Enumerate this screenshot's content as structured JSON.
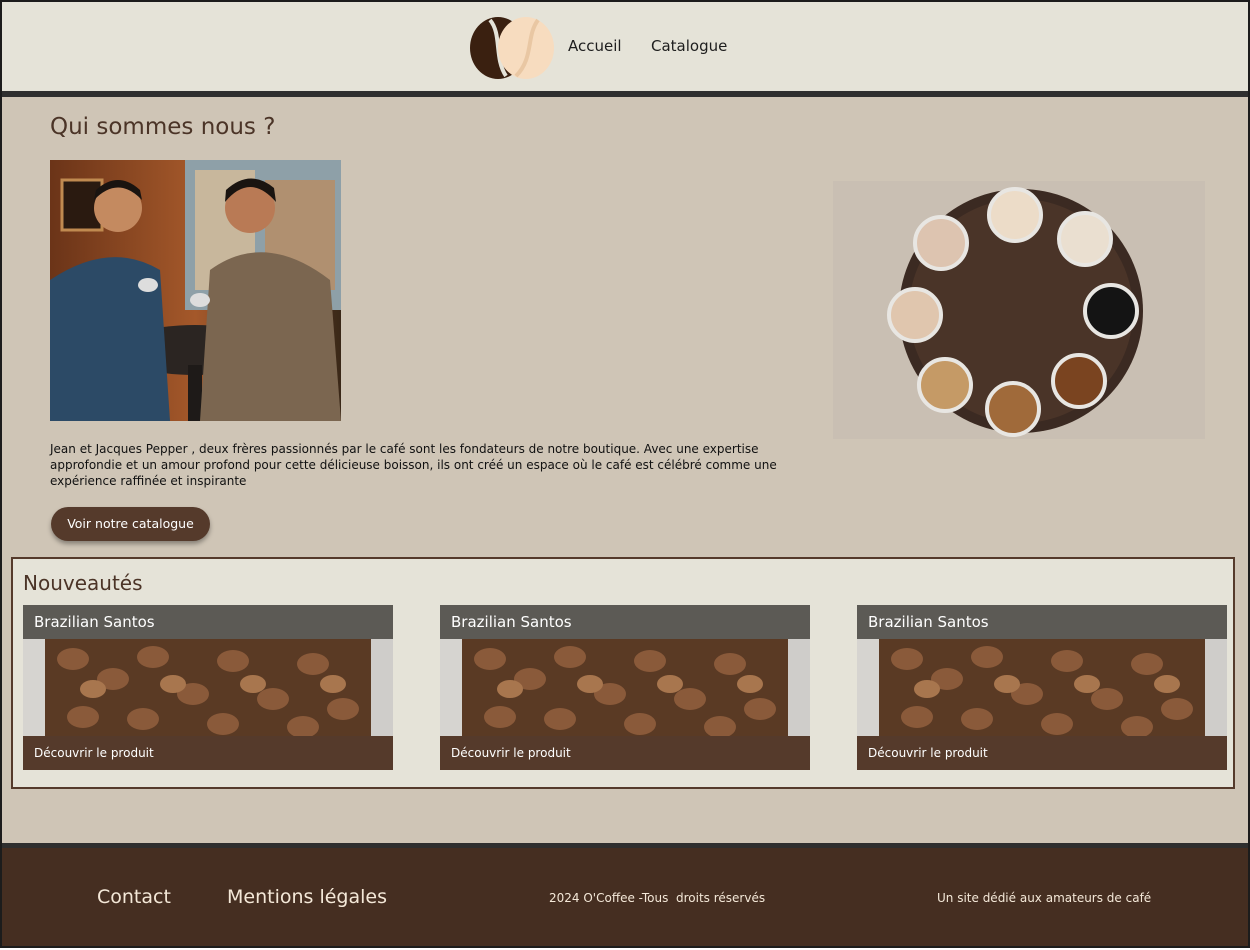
{
  "header": {
    "logo_icon": "coffee-bean-logo-icon",
    "nav": [
      {
        "label": "Accueil"
      },
      {
        "label": "Catalogue"
      }
    ]
  },
  "about": {
    "title": "Qui sommes nous ?",
    "text": "Jean et Jacques Pepper , deux frères passionnés par le café sont les fondateurs de notre boutique. Avec une expertise approfondie et un amour profond pour cette délicieuse boisson, ils ont créé un espace où le café est célébré comme une expérience raffinée et inspirante",
    "cta_label": "Voir notre catalogue"
  },
  "news": {
    "title": "Nouveautés",
    "cards": [
      {
        "name": "Brazilian Santos",
        "link_label": "Découvrir le produit"
      },
      {
        "name": "Brazilian Santos",
        "link_label": "Découvrir le produit"
      },
      {
        "name": "Brazilian Santos",
        "link_label": "Découvrir le produit"
      }
    ]
  },
  "footer": {
    "contact_label": "Contact",
    "legal_label": "Mentions légales",
    "copyright": "2024 O'Coffee -Tous  droits réservés",
    "tagline": "Un site dédié aux amateurs de café"
  },
  "colors": {
    "header_bg": "#e5e3d8",
    "page_bg": "#cfc5b6",
    "accent_brown": "#553a2b",
    "footer_bg": "#452e21",
    "card_header": "#5c5a55"
  }
}
